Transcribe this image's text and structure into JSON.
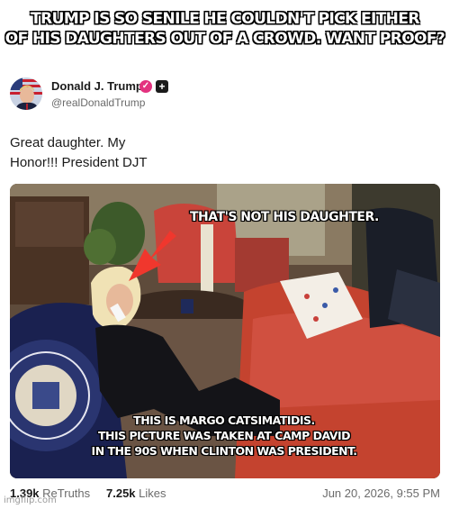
{
  "meme": {
    "top_text_line1": "TRUMP IS SO SENILE HE COULDN'T PICK EITHER",
    "top_text_line2": "OF HIS DAUGHTERS OUT OF A CROWD. WANT PROOF?"
  },
  "post": {
    "display_name": "Donald J. Trump",
    "handle": "@realDonaldTrump",
    "verified_icon": "verified-badge-icon",
    "plus_icon": "plus-icon",
    "text_line1": "Great daughter. My",
    "text_line2": "Honor!!! President DJT",
    "media": {
      "caption_top": "THAT'S NOT HIS DAUGHTER.",
      "caption_bottom_line1": "THIS IS  MARGO CATSIMATIDIS.",
      "caption_bottom_line2": "THIS PICTURE WAS TAKEN AT CAMP DAVID",
      "caption_bottom_line3": "IN THE 90S WHEN CLINTON WAS PRESIDENT."
    },
    "stats": {
      "retruths_count": "1.39k",
      "retruths_label": "ReTruths",
      "likes_count": "7.25k",
      "likes_label": "Likes",
      "timestamp": "Jun 20, 2026, 9:55 PM"
    }
  },
  "watermark": "imgflip.com",
  "colors": {
    "verified": "#e3327f",
    "arrow": "#f0372d"
  }
}
